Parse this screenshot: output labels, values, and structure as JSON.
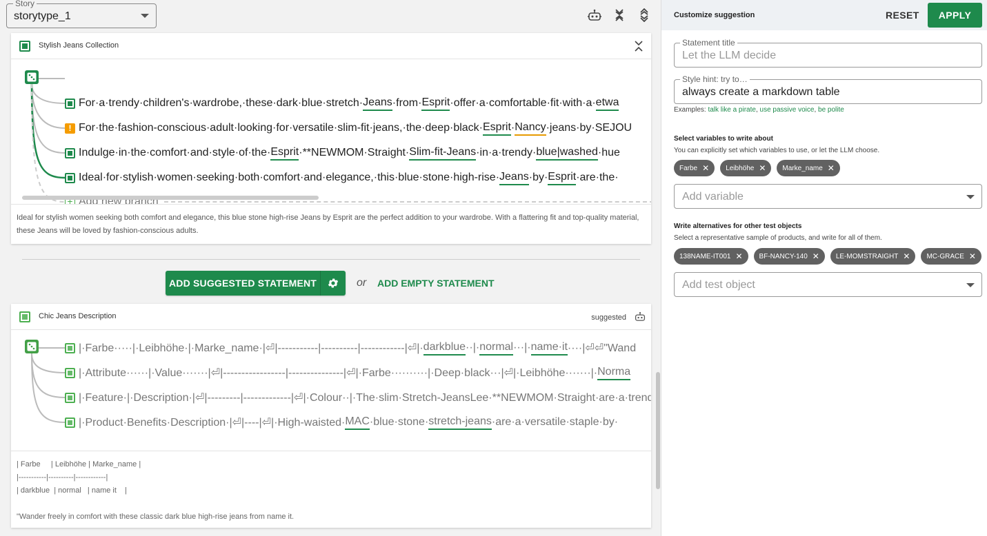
{
  "story": {
    "label": "Story",
    "value": "storytype_1"
  },
  "card1": {
    "title": "Stylish Jeans Collection",
    "branches": [
      {
        "status": "ok",
        "text": "For·a·trendy·children's·wardrobe,·these·dark·blue·stretch·",
        "tag1": "Jeans",
        "mid": "·from·",
        "tag2": "Esprit",
        "rest": "·offer·a·comfortable·fit·with·a·",
        "tag3": "etwa"
      },
      {
        "status": "warn",
        "text": "For·the·fashion-conscious·adult·looking·for·versatile·slim-fit·jeans,·the·deep·black·",
        "tag1": "Esprit",
        "mid": "·",
        "tag2": "Nancy",
        "rest": "·jeans·by·SEJOU",
        "tag3": ""
      },
      {
        "status": "ok",
        "text": "Indulge·in·the·comfort·and·style·of·the·",
        "tag1": "Esprit",
        "mid": "·**NEWMOM·Straight·",
        "tag2": "Slim-fit-Jeans",
        "rest": "·in·a·trendy·",
        "tag3": "blue|washed",
        "tail": "·hue"
      },
      {
        "status": "ok",
        "text": "Ideal·for·stylish·women·seeking·both·comfort·and·elegance,·this·blue·stone·high-rise·",
        "tag1": "Jeans",
        "mid": "·by·",
        "tag2": "Esprit",
        "rest": "·are·the·",
        "tag3": ""
      }
    ],
    "add_branch": "Add new branch",
    "preview": "Ideal for stylish women seeking both comfort and elegance, this blue stone high-rise Jeans by Esprit are the perfect addition to your wardrobe. With a flattering fit and top-quality material, these Jeans will be loved by fashion-conscious adults."
  },
  "actions": {
    "add_suggested": "ADD SUGGESTED STATEMENT",
    "or": "or",
    "add_empty": "ADD EMPTY STATEMENT"
  },
  "card2": {
    "title": "Chic Jeans Description",
    "badge": "suggested",
    "branches": [
      {
        "text": "|·Farbe·····|·Leibhöhe·|·Marke_name·|⏎|-----------|----------|------------|⏎|·",
        "tag1": "darkblue",
        "mid": "··|·",
        "tag2": "normal",
        "rest": "···|·",
        "tag3": "name·it",
        "tail": "····|⏎⏎\"Wand"
      },
      {
        "text": "|·Attribute······|·Value·······|⏎|-----------------|---------------|⏎|·Farbe··········|·Deep·black···|⏎|·Leibhöhe·······|·",
        "tag1": "",
        "mid": "",
        "tag2": "",
        "rest": "",
        "tag3": "Norma"
      },
      {
        "text": "|·Feature·|·Description·|⏎|---------|-------------|⏎|·Colour··|·The·slim·Stretch-JeansLee·**NEWMOM·Straight·are·a·trend",
        "tag1": "",
        "mid": "",
        "tag2": "",
        "rest": "",
        "tag3": ""
      },
      {
        "text": "|·Product·Benefits·Description·|⏎|----|⏎|·High-waisted·",
        "tag1": "MAC",
        "mid": "·blue·stone·",
        "tag2": "stretch-jeans",
        "rest": "·are·a·versatile·staple·by·",
        "tag3": ""
      }
    ],
    "preview_lines": [
      "| Farbe     | Leibhöhe | Marke_name |",
      "|-----------|----------|------------|",
      "| darkblue  | normal   | name it    |",
      "",
      "\"Wander freely in comfort with these classic dark blue high-rise jeans from name it."
    ]
  },
  "panel": {
    "title": "Customize suggestion",
    "reset": "RESET",
    "apply": "APPLY",
    "statement_title": {
      "label": "Statement title",
      "placeholder": "Let the LLM decide"
    },
    "style_hint": {
      "label": "Style hint: try to…",
      "value": "always create a markdown table"
    },
    "examples_prefix": "Examples: ",
    "examples": [
      "talk like a pirate",
      "use passive voice",
      "be polite"
    ],
    "variables": {
      "title": "Select variables to write about",
      "subtitle": "You can explicitly set which variables to use, or let the LLM choose.",
      "chips": [
        "Farbe",
        "Leibhöhe",
        "Marke_name"
      ],
      "placeholder": "Add variable"
    },
    "objects": {
      "title": "Write alternatives for other test objects",
      "subtitle": "Select a representative sample of products, and write for all of them.",
      "chips": [
        "138NAME-IT001",
        "BF-NANCY-140",
        "LE-MOMSTRAIGHT",
        "MC-GRACE"
      ],
      "placeholder": "Add test object"
    }
  },
  "colors": {
    "accent": "#1e8a4c",
    "warn": "#f59c00",
    "chip": "#616161",
    "underline_ok": "#1e8a4c",
    "underline_warn": "#e69a00"
  }
}
